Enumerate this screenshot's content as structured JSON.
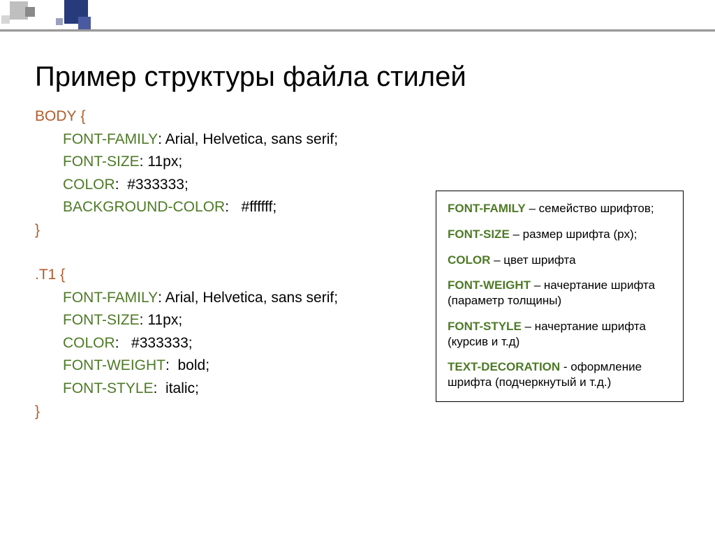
{
  "title": "Пример структуры файла стилей",
  "css_rules": [
    {
      "selector": "Body",
      "selector_class": "sel-body",
      "decls": [
        {
          "prop": "font-family",
          "value": "Arial, Helvetica, sans serif;"
        },
        {
          "prop": "font-size",
          "value": "11px;"
        },
        {
          "prop": "color",
          "value": " #333333;"
        },
        {
          "prop": "background-color",
          "value": "  #ffffff;"
        }
      ]
    },
    {
      "selector": ".T1",
      "selector_class": "sel-class",
      "decls": [
        {
          "prop": "font-family",
          "value": "Arial, Helvetica, sans serif;"
        },
        {
          "prop": "font-size",
          "value": "11px;"
        },
        {
          "prop": "color",
          "value": "  #333333;"
        },
        {
          "prop": "font-weight",
          "value": " bold;"
        },
        {
          "prop": "font-style",
          "value": " italic;"
        }
      ]
    }
  ],
  "legend": [
    {
      "term": "Font-family",
      "desc": " – семейство шрифтов;"
    },
    {
      "term": "Font-size",
      "desc": " – размер шрифта (px);"
    },
    {
      "term": "Color",
      "desc": " – цвет шрифта"
    },
    {
      "term": "Font-weight",
      "desc": " – начертание шрифта (параметр толщины)"
    },
    {
      "term": "Font-style",
      "desc": " – начертание шрифта (курсив и т.д)"
    },
    {
      "term": "Text-decoration",
      "desc": "  - оформление шрифта (подчеркнутый и т.д.)"
    }
  ]
}
